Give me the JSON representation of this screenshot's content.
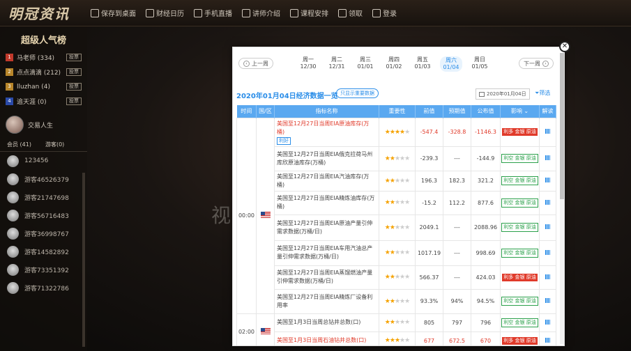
{
  "topbar": {
    "logo": "明冠资讯",
    "nav": [
      "保存到桌面",
      "财经日历",
      "手机直播",
      "讲师介绍",
      "课程安排",
      "领取",
      "登录"
    ]
  },
  "sidebar": {
    "title": "超级人气榜",
    "ranks": [
      {
        "num": "1",
        "name": "马老师 (334)",
        "btn": "投票",
        "color": "#c0392b"
      },
      {
        "num": "2",
        "name": "点点滴滴 (212)",
        "btn": "投票",
        "color": "#b8862b"
      },
      {
        "num": "3",
        "name": "lluzhan (4)",
        "btn": "投票",
        "color": "#b8862b"
      },
      {
        "num": "4",
        "name": "追天涯 (0)",
        "btn": "投票",
        "color": "#2a4aa8"
      }
    ],
    "host": "交易人生",
    "tabs": [
      "会员 (41)",
      "游客(0)"
    ],
    "users": [
      "123456",
      "游客46526379",
      "游客21747698",
      "游客56716483",
      "游客36998767",
      "游客14582892",
      "游客73351392",
      "游客71322786"
    ]
  },
  "watermark": "视",
  "modal": {
    "prev": "上一周",
    "next": "下一周",
    "days": [
      {
        "w": "周一",
        "d": "12/30"
      },
      {
        "w": "周二",
        "d": "12/31"
      },
      {
        "w": "周三",
        "d": "01/01"
      },
      {
        "w": "周四",
        "d": "01/02"
      },
      {
        "w": "周五",
        "d": "01/03"
      },
      {
        "w": "周六",
        "d": "01/04"
      },
      {
        "w": "周日",
        "d": "01/05"
      }
    ],
    "title": "2020年01月04日经济数据一览",
    "important": "只显示重要数据",
    "date_value": "2020年01月04日",
    "filter": "筛选",
    "columns": [
      "时间",
      "国/区",
      "指标名称",
      "重要性",
      "前值",
      "预期值",
      "公布值",
      "影响 ⌄",
      "解读"
    ],
    "groups": [
      {
        "time": "00:00",
        "rows": [
          {
            "name": "美国至12月27日当周EIA原油库存(万桶)",
            "tag": "利好",
            "red": true,
            "stars": 4,
            "prev": "-547.4",
            "exp": "-328.8",
            "act": "-1146.3",
            "neg": true,
            "impact": "利多 金银 原油",
            "bad": true
          },
          {
            "name": "美国至12月27日当周EIA俄克拉荷马州库欣原油库存(万桶)",
            "stars": 2,
            "prev": "-239.3",
            "exp": "---",
            "act": "-144.9",
            "impact": "利空 金银 原油"
          },
          {
            "name": "美国至12月27日当周EIA汽油库存(万桶)",
            "stars": 2,
            "prev": "196.3",
            "exp": "182.3",
            "act": "321.2",
            "impact": "利空 金银 原油"
          },
          {
            "name": "美国至12月27日当周EIA精炼油库存(万桶)",
            "stars": 2,
            "prev": "-15.2",
            "exp": "112.2",
            "act": "877.6",
            "impact": "利空 金银 原油"
          },
          {
            "name": "美国至12月27日当周EIA原油产量引伸需求数据(万桶/日)",
            "stars": 2,
            "prev": "2049.1",
            "exp": "---",
            "act": "2088.96",
            "impact": "利空 金银 原油"
          },
          {
            "name": "美国至12月27日当周EIA车用汽油总产量引伸需求数据(万桶/日)",
            "stars": 2,
            "prev": "1017.19",
            "exp": "---",
            "act": "998.69",
            "impact": "利空 金银 原油"
          },
          {
            "name": "美国至12月27日当周EIA蒸馏燃油产量引伸需求数据(万桶/日)",
            "stars": 2,
            "prev": "566.37",
            "exp": "---",
            "act": "424.03",
            "impact": "利多 金银 原油",
            "bad": true
          },
          {
            "name": "美国至12月27日当周EIA精炼厂设备利用率",
            "stars": 2,
            "prev": "93.3%",
            "exp": "94%",
            "act": "94.5%",
            "impact": "利空 金银 原油"
          }
        ]
      },
      {
        "time": "02:00",
        "rows": [
          {
            "name": "美国至1月3日当周总钻井总数(口)",
            "stars": 2,
            "prev": "805",
            "exp": "797",
            "act": "796",
            "impact": "利空 金银 原油"
          },
          {
            "name": "美国至1月3日当周石油钻井总数(口)",
            "red": true,
            "stars": 3,
            "prev": "677",
            "exp": "672.5",
            "act": "670",
            "neg": true,
            "impact": "利多 金银 原油",
            "bad": true
          }
        ]
      }
    ]
  }
}
